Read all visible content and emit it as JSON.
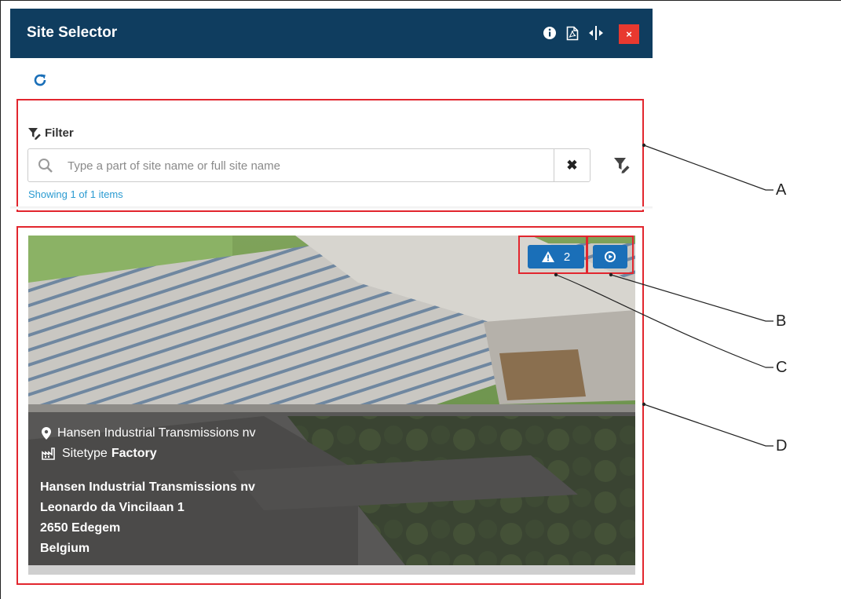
{
  "window": {
    "title": "Site Selector",
    "close_label": "×",
    "icons": [
      "info-icon",
      "pdf-icon",
      "resize-icon",
      "close-icon"
    ]
  },
  "toolbar": {
    "refresh_icon": "refresh-icon"
  },
  "filter": {
    "heading": "Filter",
    "search_placeholder": "Type a part of site name or full site name",
    "search_value": "",
    "clear_label": "✖",
    "count_text": "Showing 1 of 1 items"
  },
  "site_card": {
    "alarm_count": "2",
    "location_name": "Hansen Industrial Transmissions nv",
    "sitetype_label": "Sitetype",
    "sitetype_value": "Factory",
    "address_lines": [
      "Hansen Industrial Transmissions nv",
      "Leonardo da Vincilaan 1",
      "2650 Edegem",
      "Belgium"
    ]
  },
  "callouts": {
    "a": "A",
    "b": "B",
    "c": "C",
    "d": "D"
  },
  "colors": {
    "titlebar": "#0f3d5f",
    "close": "#e8392f",
    "accent": "#1a6fb8",
    "highlight_box": "#e2262e",
    "link": "#2b9bd1"
  }
}
